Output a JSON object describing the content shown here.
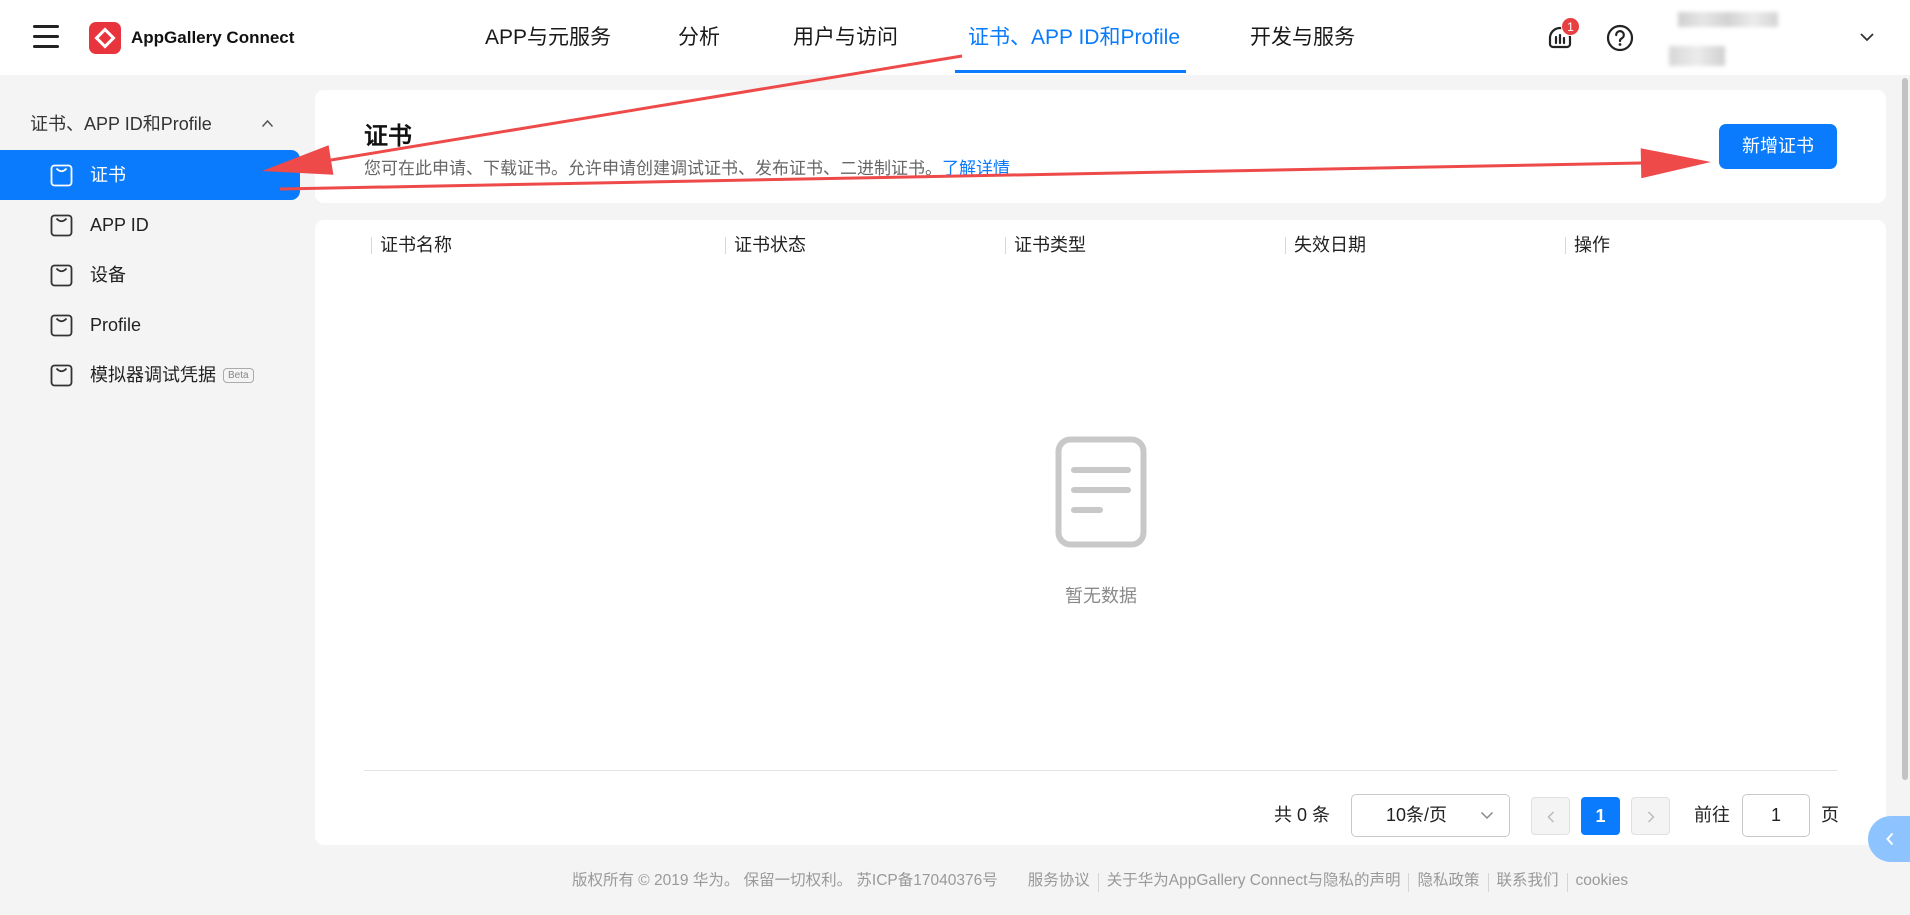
{
  "header": {
    "app_name": "AppGallery Connect",
    "nav": [
      {
        "label": "APP与元服务"
      },
      {
        "label": "分析"
      },
      {
        "label": "用户与访问"
      },
      {
        "label": "证书、APP ID和Profile"
      },
      {
        "label": "开发与服务"
      }
    ],
    "notification_count": "1"
  },
  "sidebar": {
    "group_title": "证书、APP ID和Profile",
    "items": [
      {
        "label": "证书"
      },
      {
        "label": "APP ID"
      },
      {
        "label": "设备"
      },
      {
        "label": "Profile"
      },
      {
        "label": "模拟器调试凭据",
        "badge": "Beta"
      }
    ]
  },
  "page": {
    "title": "证书",
    "description": "您可在此申请、下载证书。允许申请创建调试证书、发布证书、二进制证书。",
    "learn_more": "了解详情",
    "add_button": "新增证书"
  },
  "table": {
    "columns": [
      "证书名称",
      "证书状态",
      "证书类型",
      "失效日期",
      "操作"
    ],
    "rows": [],
    "empty_text": "暂无数据"
  },
  "pagination": {
    "total_label": "共 0 条",
    "page_size": "10条/页",
    "current_page": "1",
    "goto_label": "前往",
    "goto_value": "1",
    "page_suffix": "页"
  },
  "footer": {
    "copyright": "版权所有 © 2019 华为。 保留一切权利。 苏ICP备17040376号",
    "links": [
      "服务协议",
      "关于华为AppGallery Connect与隐私的声明",
      "隐私政策",
      "联系我们",
      "cookies"
    ]
  },
  "colors": {
    "primary": "#0a7bfd",
    "annotation_arrow": "#ee4a4a",
    "notification_badge": "#e84040",
    "logo": "#e8343d",
    "page_background": "#f4f4f4"
  },
  "icons": {
    "menu": "hamburger-icon",
    "logo": "appgallery-logo-icon",
    "customer_service": "customer-service-icon",
    "help": "help-icon",
    "sidebar_item": "page-icon",
    "empty": "empty-document-icon"
  }
}
